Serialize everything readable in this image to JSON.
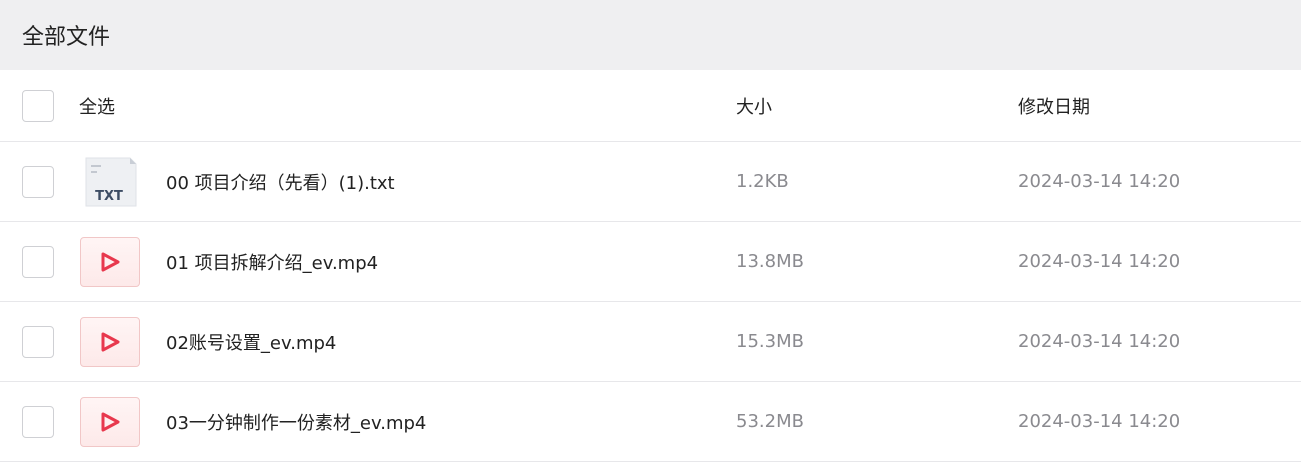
{
  "title": "全部文件",
  "header": {
    "select_all": "全选",
    "size": "大小",
    "modified": "修改日期"
  },
  "files": [
    {
      "name": "00 项目介绍（先看）(1).txt",
      "size": "1.2KB",
      "date": "2024-03-14 14:20",
      "type": "txt",
      "type_label": "TXT"
    },
    {
      "name": "01 项目拆解介绍_ev.mp4",
      "size": "13.8MB",
      "date": "2024-03-14 14:20",
      "type": "video"
    },
    {
      "name": "02账号设置_ev.mp4",
      "size": "15.3MB",
      "date": "2024-03-14 14:20",
      "type": "video"
    },
    {
      "name": "03一分钟制作一份素材_ev.mp4",
      "size": "53.2MB",
      "date": "2024-03-14 14:20",
      "type": "video"
    }
  ],
  "colors": {
    "titlebar_bg": "#efeff1",
    "video_icon": "#e8384d",
    "txt_icon": "#3d4d64"
  }
}
